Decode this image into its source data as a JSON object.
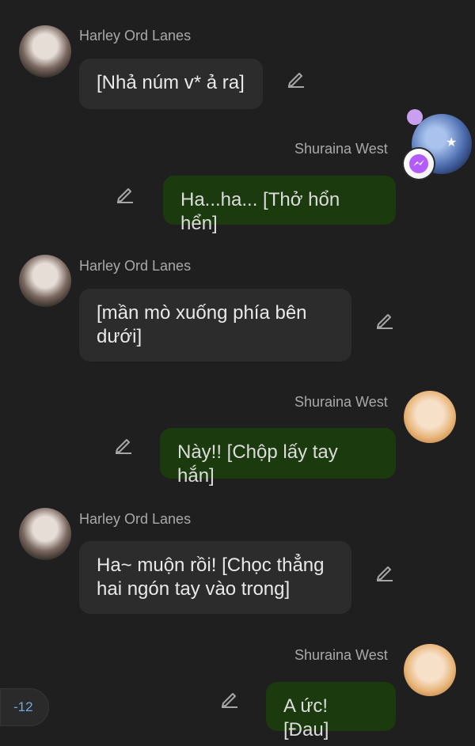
{
  "messages": [
    {
      "sender": "Harley Ord Lanes",
      "side": "in",
      "text": "[Nhả núm v* ả ra]"
    },
    {
      "sender": "Shuraina West",
      "side": "out",
      "text": "Ha...ha... [Thở hổn hển]"
    },
    {
      "sender": "Harley Ord Lanes",
      "side": "in",
      "text": "[mần mò xuống phía bên\ndưới]"
    },
    {
      "sender": "Shuraina West",
      "side": "out",
      "text": "Này!! [Chộp lấy tay hắn]"
    },
    {
      "sender": "Harley Ord Lanes",
      "side": "in",
      "text": "Ha~ muộn rồi! [Chọc thẳng\nhai ngón tay vào trong]"
    },
    {
      "sender": "Shuraina West",
      "side": "out",
      "text": "A ức! [Đau]"
    }
  ],
  "badge": {
    "value": "-12"
  },
  "icons": {
    "edit": "pencil-icon",
    "messenger": "messenger-icon"
  },
  "colors": {
    "background": "#1f1f1f",
    "incoming_bubble": "#2c2c2c",
    "outgoing_bubble": "#1b3a0d",
    "badge_text": "#6fa8e0"
  }
}
